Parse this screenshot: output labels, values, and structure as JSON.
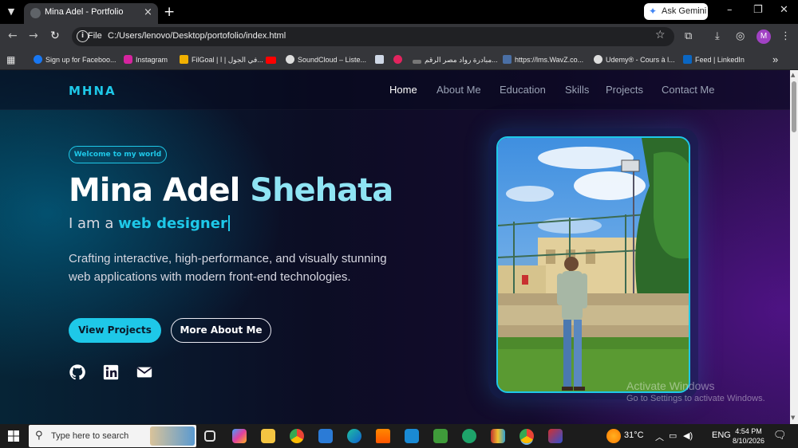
{
  "browser": {
    "tab_title": "Mina Adel - Portfolio",
    "tab_close": "×",
    "new_tab": "+",
    "ask_gemini": "Ask Gemini",
    "omnibox_scheme": "File",
    "omnibox_url": "C:/Users/lenovo/Desktop/portofolio/index.html",
    "profile_initial": "M",
    "bookmarks": [
      {
        "label": "Sign up for Faceboo...",
        "color": "#1877f2"
      },
      {
        "label": "Instagram",
        "color": "#d6249f"
      },
      {
        "label": "FilGoal | في الجول | ا...",
        "color": "#f0b000"
      },
      {
        "label": "",
        "color": "#ff0000"
      },
      {
        "label": "SoundCloud – Liste...",
        "color": "#dddddd"
      },
      {
        "label": "",
        "color": "#cfd8e6"
      },
      {
        "label": "",
        "color": "#e2245e"
      },
      {
        "label": "مبادرة رواد مصر الرقم...",
        "color": "#777777"
      },
      {
        "label": "https://lms.WavZ.co...",
        "color": "#4a6fa5"
      },
      {
        "label": "Udemy® - Cours à l...",
        "color": "#dddddd"
      },
      {
        "label": "Feed | LinkedIn",
        "color": "#0a66c2"
      }
    ],
    "bookmarks_overflow": "»"
  },
  "page": {
    "logo": "MHNA",
    "nav": [
      "Home",
      "About Me",
      "Education",
      "Skills",
      "Projects",
      "Contact Me"
    ],
    "badge": "Welcome to my world",
    "name_first": "Mina Adel ",
    "name_last": "Shehata",
    "role_prefix": "I am a ",
    "role_highlight": "web designer",
    "description": "Crafting interactive, high-performance, and visually stunning web applications with modern front-end technologies.",
    "btn_primary": "View Projects",
    "btn_secondary": "More About Me",
    "socials": [
      "github-icon",
      "linkedin-icon",
      "email-icon"
    ],
    "accent_color": "#1ec8e8"
  },
  "os": {
    "watermark_title": "Activate Windows",
    "watermark_sub": "Go to Settings to activate Windows.",
    "search_placeholder": "Type here to search",
    "weather": "31°C",
    "language": "ENG",
    "time": "4:54 PM",
    "date": "8/10/2026"
  }
}
